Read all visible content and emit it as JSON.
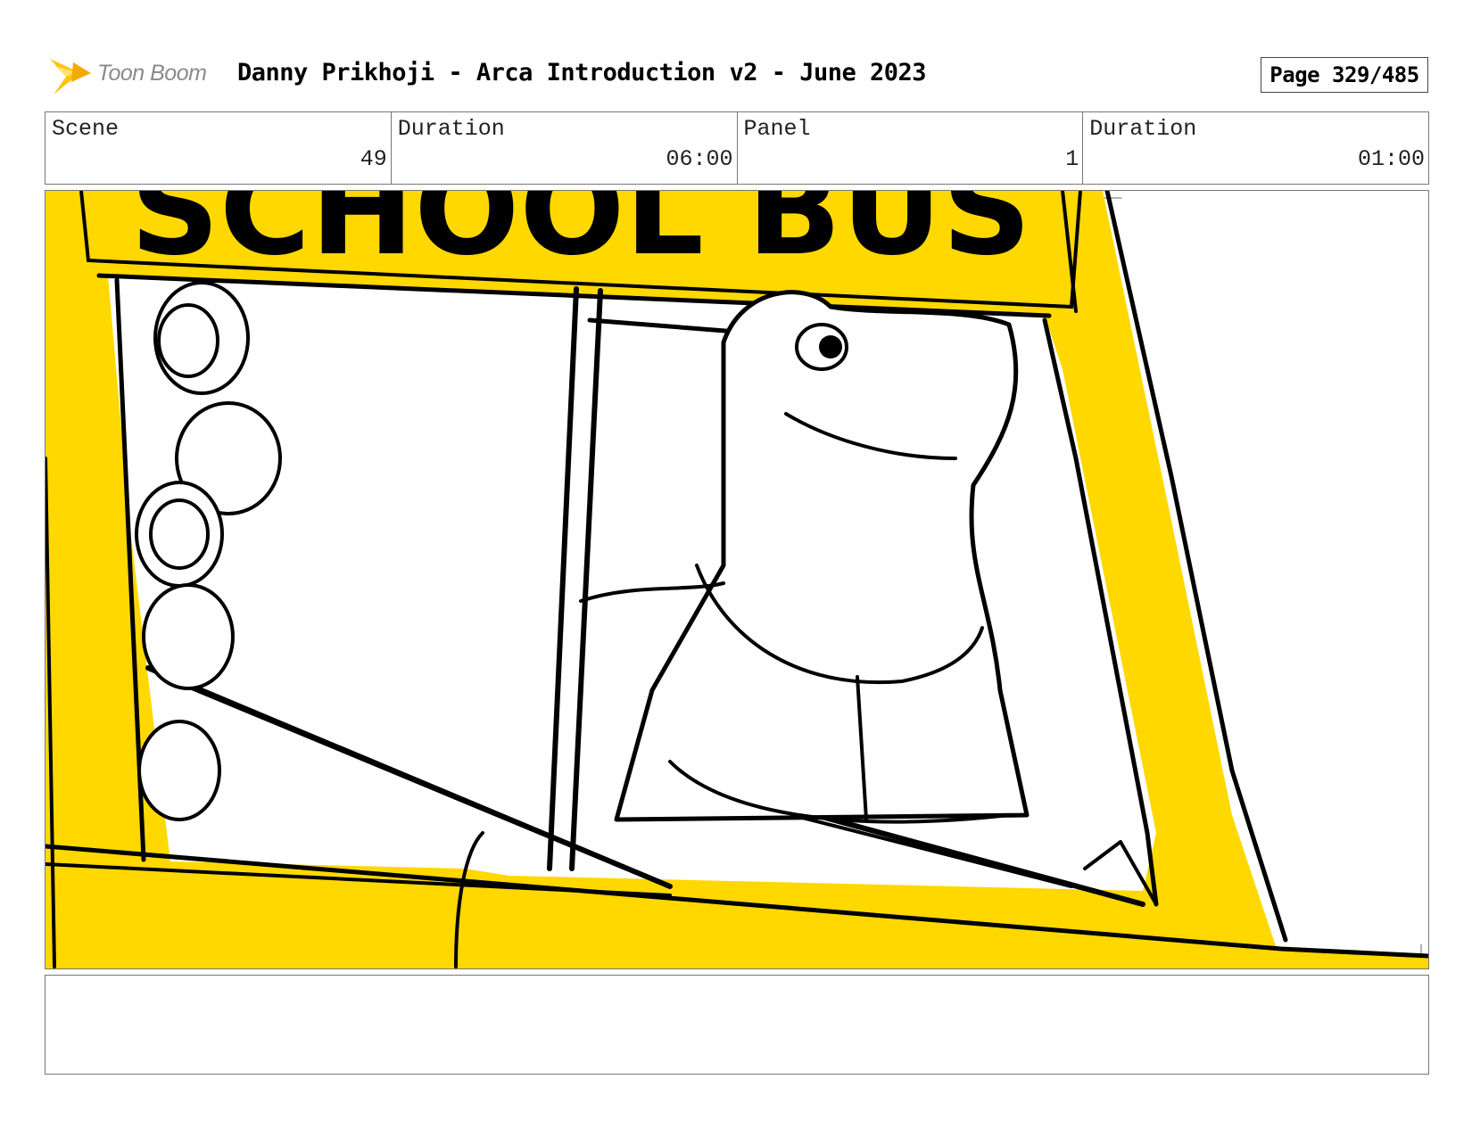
{
  "header": {
    "logo_text": "Toon Boom",
    "title": "Danny Prikhoji - Arca Introduction v2 - June 2023",
    "page": "Page 329/485"
  },
  "info": {
    "scene_label": "Scene",
    "scene_value": "49",
    "scene_duration_label": "Duration",
    "scene_duration_value": "06:00",
    "panel_label": "Panel",
    "panel_value": "1",
    "panel_duration_label": "Duration",
    "panel_duration_value": "01:00"
  },
  "panel_image": {
    "sign_text": "SCHOOL BUS",
    "colors": {
      "bus_yellow": "#ffd800",
      "ink": "#000000"
    }
  },
  "notes": {
    "text": ""
  }
}
